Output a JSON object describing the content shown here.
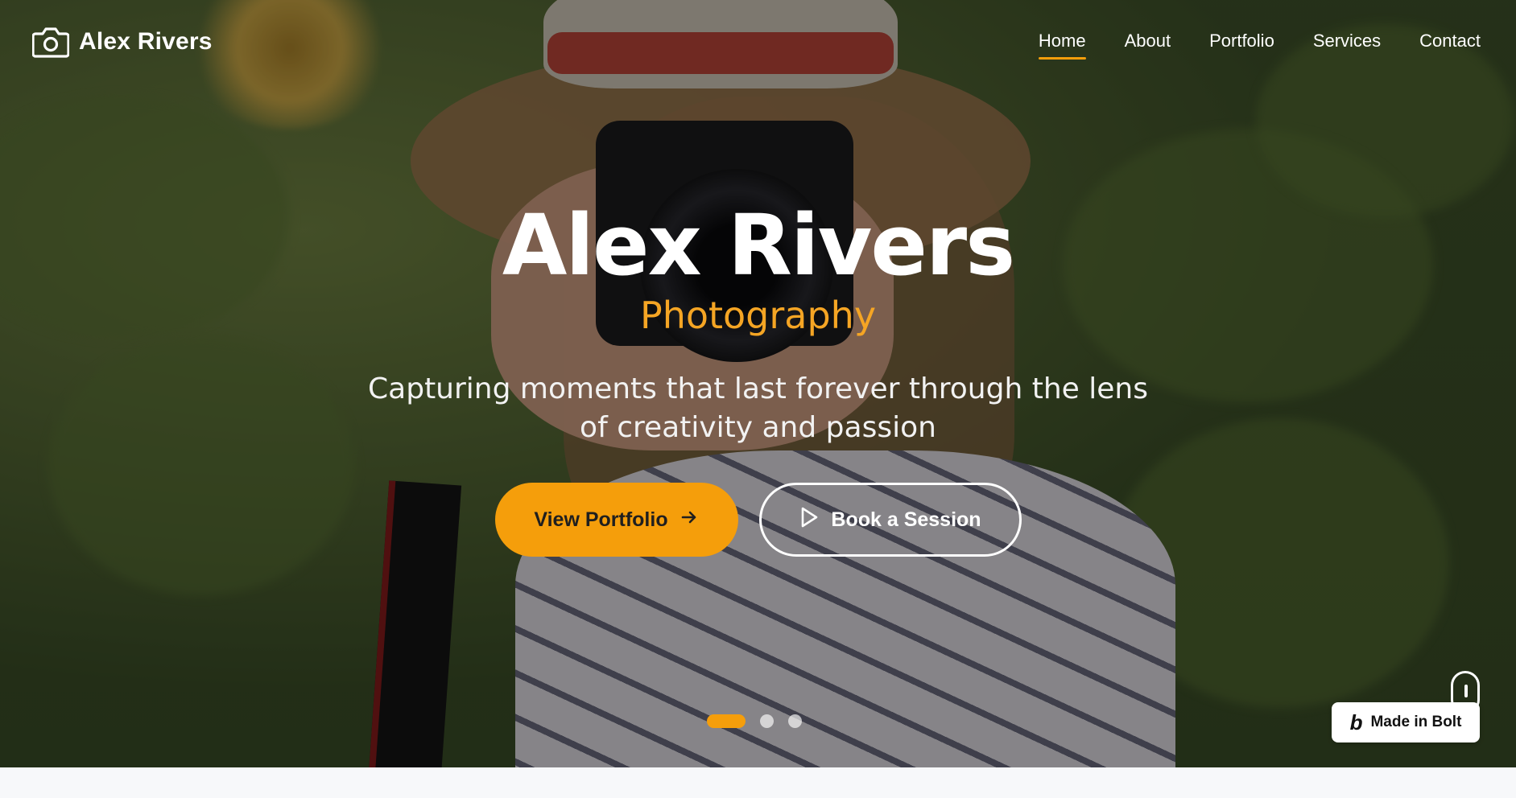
{
  "brand": {
    "name": "Alex Rivers",
    "icon": "camera-icon"
  },
  "nav": {
    "items": [
      {
        "label": "Home",
        "active": true
      },
      {
        "label": "About",
        "active": false
      },
      {
        "label": "Portfolio",
        "active": false
      },
      {
        "label": "Services",
        "active": false
      },
      {
        "label": "Contact",
        "active": false
      }
    ]
  },
  "hero": {
    "title": "Alex Rivers",
    "subtitle": "Photography",
    "tagline": "Capturing moments that last forever through the lens of creativity and passion",
    "primary_button": {
      "label": "View Portfolio",
      "icon": "arrow-right-icon"
    },
    "secondary_button": {
      "label": "Book a Session",
      "icon": "play-icon"
    }
  },
  "carousel": {
    "slide_count": 3,
    "active_index": 0
  },
  "badge": {
    "logo": "b",
    "label": "Made in Bolt"
  },
  "colors": {
    "accent": "#f59e0b",
    "text": "#ffffff",
    "button_text": "#1f1f1f",
    "page_background": "#f7f8fa"
  }
}
